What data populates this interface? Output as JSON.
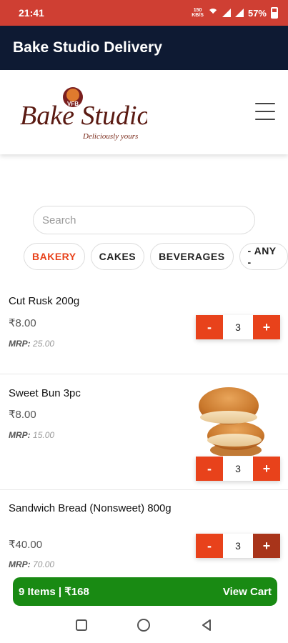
{
  "status": {
    "time": "21:41",
    "net_top": "150",
    "net_bottom": "KB/S",
    "battery": "57%"
  },
  "appbar": {
    "title": "Bake Studio Delivery"
  },
  "logo": {
    "brand": "Bake Studio",
    "badge": "VFB",
    "tagline": "Deliciously yours"
  },
  "search": {
    "placeholder": "Search",
    "value": ""
  },
  "categories": [
    {
      "label": "BAKERY",
      "active": true
    },
    {
      "label": "CAKES",
      "active": false
    },
    {
      "label": "BEVERAGES",
      "active": false
    },
    {
      "label": "- ANY -",
      "active": false
    }
  ],
  "products": [
    {
      "name": "Cut Rusk 200g",
      "price": "₹8.00",
      "mrp_label": "MRP:",
      "mrp": "25.00",
      "qty": "3",
      "minus": "-",
      "plus": "+"
    },
    {
      "name": "Sweet Bun 3pc",
      "price": "₹8.00",
      "mrp_label": "MRP:",
      "mrp": "15.00",
      "qty": "3",
      "minus": "-",
      "plus": "+"
    },
    {
      "name": "Sandwich Bread (Nonsweet) 800g",
      "price": "₹40.00",
      "mrp_label": "MRP:",
      "mrp": "70.00",
      "qty": "3",
      "minus": "-",
      "plus": "+"
    }
  ],
  "cart": {
    "summary": "9 Items | ₹168",
    "action": "View Cart"
  },
  "colors": {
    "accent": "#e8421b",
    "appbar": "#0e1a33",
    "statusbar": "#cf3f33",
    "cart": "#198a13"
  }
}
